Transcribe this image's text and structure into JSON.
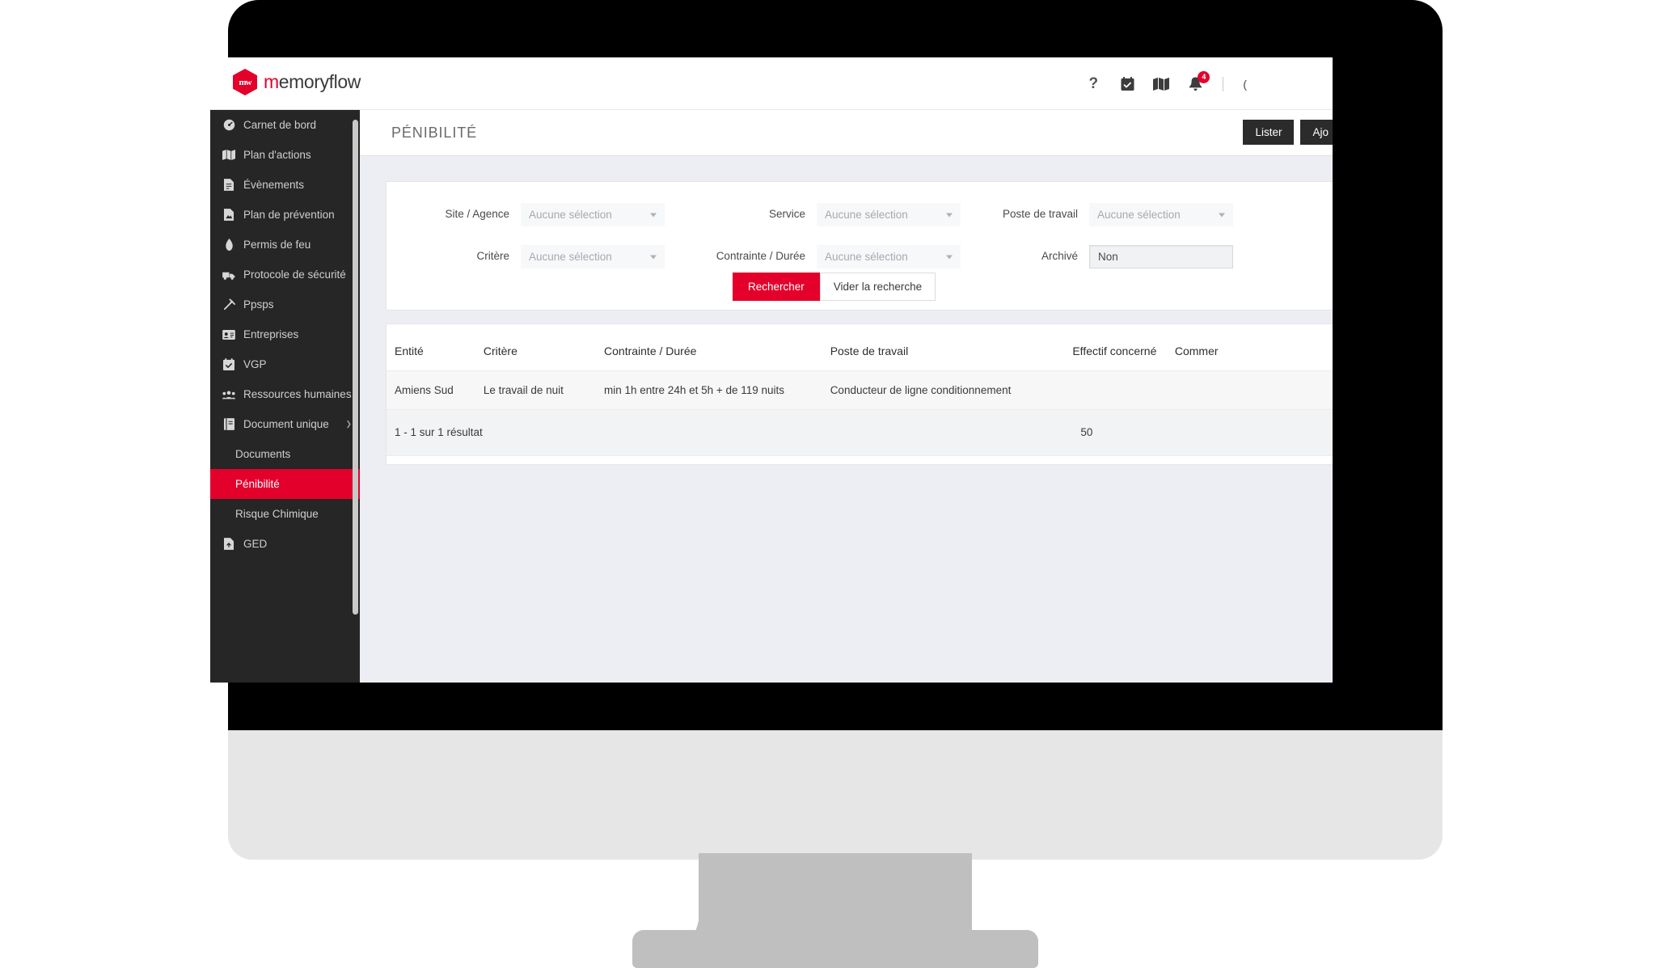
{
  "brand": {
    "mark_text": "mw",
    "name_part1": "m",
    "name_part2": "emory",
    "name_part3": "flow",
    "accent_color": "#e3002b"
  },
  "topbar": {
    "icons": [
      {
        "name": "help-icon",
        "glyph": "?"
      },
      {
        "name": "calendar-check-icon",
        "glyph": "calendar"
      },
      {
        "name": "map-icon",
        "glyph": "map"
      },
      {
        "name": "bell-icon",
        "glyph": "bell"
      }
    ],
    "notification_count": "4",
    "user_chip": "("
  },
  "sidebar": {
    "items": [
      {
        "label": "Carnet de bord",
        "icon": "gauge-icon",
        "active": false,
        "sub": false
      },
      {
        "label": "Plan d'actions",
        "icon": "map-icon",
        "active": false,
        "sub": false
      },
      {
        "label": "Évènements",
        "icon": "file-icon",
        "active": false,
        "sub": false
      },
      {
        "label": "Plan de prévention",
        "icon": "file-image-icon",
        "active": false,
        "sub": false
      },
      {
        "label": "Permis de feu",
        "icon": "flame-icon",
        "active": false,
        "sub": false
      },
      {
        "label": "Protocole de sécurité",
        "icon": "truck-icon",
        "active": false,
        "sub": false
      },
      {
        "label": "Ppsps",
        "icon": "hammer-icon",
        "active": false,
        "sub": false
      },
      {
        "label": "Entreprises",
        "icon": "id-card-icon",
        "active": false,
        "sub": false
      },
      {
        "label": "VGP",
        "icon": "calendar-check-icon",
        "active": false,
        "sub": false
      },
      {
        "label": "Ressources humaines",
        "icon": "users-icon",
        "active": false,
        "sub": false
      },
      {
        "label": "Document unique",
        "icon": "book-icon",
        "active": false,
        "sub": false,
        "caret": "❯"
      },
      {
        "label": "Documents",
        "icon": "",
        "active": false,
        "sub": true
      },
      {
        "label": "Pénibilité",
        "icon": "",
        "active": true,
        "sub": true
      },
      {
        "label": "Risque Chimique",
        "icon": "",
        "active": false,
        "sub": true
      },
      {
        "label": "GED",
        "icon": "file-upload-icon",
        "active": false,
        "sub": false
      }
    ]
  },
  "page": {
    "title": "PÉNIBILITÉ",
    "actions": [
      {
        "label": "Lister",
        "name": "lister-button"
      },
      {
        "label": "Ajo",
        "name": "ajouter-button"
      }
    ]
  },
  "filters": {
    "placeholder_none": "Aucune sélection",
    "fields": [
      {
        "label": "Site / Agence",
        "value": "Aucune sélection",
        "name": "site-agence-select",
        "filled": false
      },
      {
        "label": "Service",
        "value": "Aucune sélection",
        "name": "service-select",
        "filled": false
      },
      {
        "label": "Poste de travail",
        "value": "Aucune sélection",
        "name": "poste-travail-select",
        "filled": false
      },
      {
        "label": "Critère",
        "value": "Aucune sélection",
        "name": "critere-select",
        "filled": false
      },
      {
        "label": "Contrainte / Durée",
        "value": "Aucune sélection",
        "name": "contrainte-duree-select",
        "filled": false
      },
      {
        "label": "Archivé",
        "value": "Non",
        "name": "archive-select",
        "filled": true
      }
    ],
    "search_button": "Rechercher",
    "clear_button": "Vider la recherche"
  },
  "results": {
    "columns": [
      "Entité",
      "Critère",
      "Contrainte / Durée",
      "Poste de travail",
      "Effectif concerné",
      "Commer"
    ],
    "rows": [
      {
        "entite": "Amiens Sud",
        "critere": "Le travail de nuit",
        "contrainte": "min 1h entre 24h et 5h + de 119 nuits",
        "poste": "Conducteur de ligne conditionnement",
        "effectif": "",
        "commentaire": ""
      }
    ],
    "footer_count": "1 - 1 sur 1 résultat",
    "footer_effectif": "50"
  }
}
